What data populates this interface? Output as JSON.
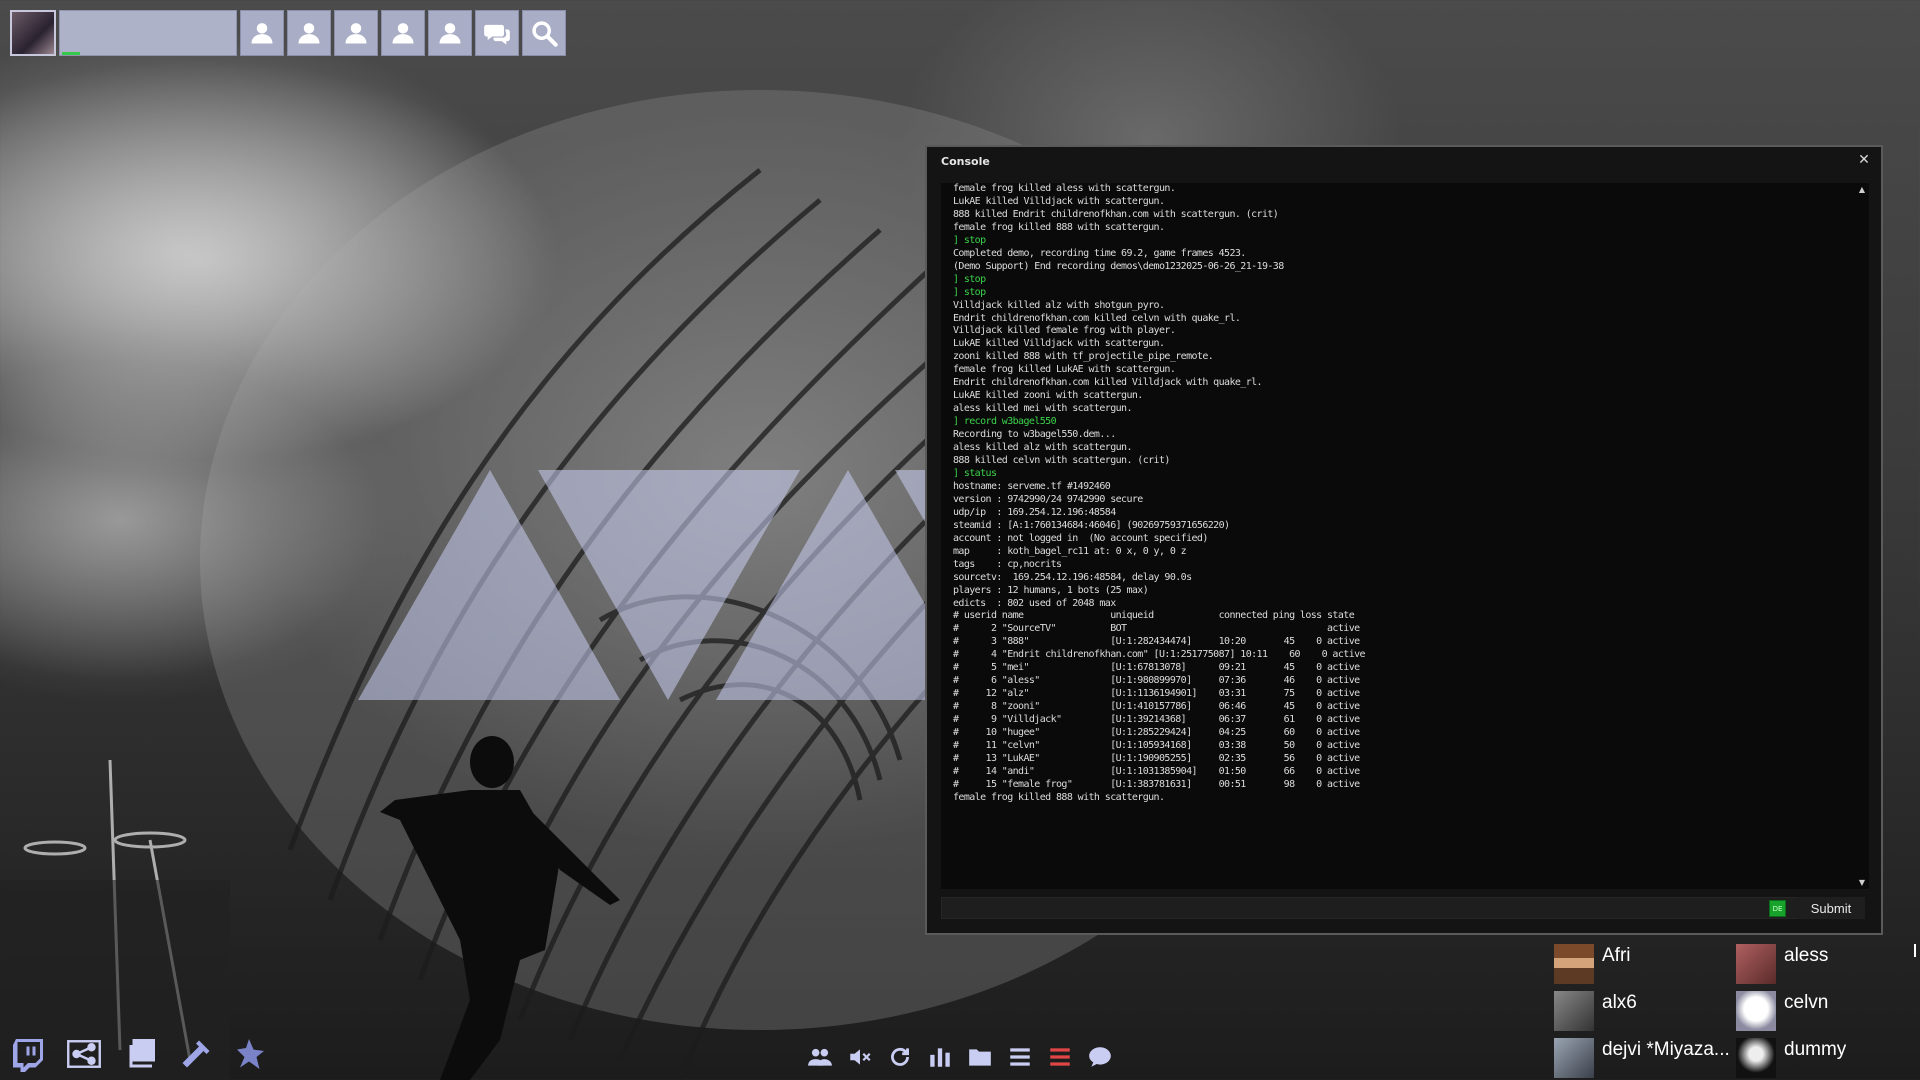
{
  "topbar": {
    "name_value": "",
    "buttons": [
      "user-icon",
      "user-icon",
      "user-icon",
      "user-icon",
      "user-icon",
      "chat-icon",
      "search-icon"
    ]
  },
  "console": {
    "title": "Console",
    "close_glyph": "✕",
    "lines": [
      {
        "text": "female frog killed aless with scattergun.",
        "cmd": false
      },
      {
        "text": "LukAE killed Villdjack with scattergun.",
        "cmd": false
      },
      {
        "text": "888 killed Endrit childrenofkhan.com with scattergun. (crit)",
        "cmd": false
      },
      {
        "text": "female frog killed 888 with scattergun.",
        "cmd": false
      },
      {
        "text": "] stop",
        "cmd": true
      },
      {
        "text": "Completed demo, recording time 69.2, game frames 4523.",
        "cmd": false
      },
      {
        "text": "(Demo Support) End recording demos\\demo1232025-06-26_21-19-38",
        "cmd": false
      },
      {
        "text": "] stop",
        "cmd": true
      },
      {
        "text": "] stop",
        "cmd": true
      },
      {
        "text": "Villdjack killed alz with shotgun_pyro.",
        "cmd": false
      },
      {
        "text": "Endrit childrenofkhan.com killed celvn with quake_rl.",
        "cmd": false
      },
      {
        "text": "Villdjack killed female frog with player.",
        "cmd": false
      },
      {
        "text": "LukAE killed Villdjack with scattergun.",
        "cmd": false
      },
      {
        "text": "zooni killed 888 with tf_projectile_pipe_remote.",
        "cmd": false
      },
      {
        "text": "female frog killed LukAE with scattergun.",
        "cmd": false
      },
      {
        "text": "Endrit childrenofkhan.com killed Villdjack with quake_rl.",
        "cmd": false
      },
      {
        "text": "LukAE killed zooni with scattergun.",
        "cmd": false
      },
      {
        "text": "aless killed mei with scattergun.",
        "cmd": false
      },
      {
        "text": "] record w3bagel550",
        "cmd": true
      },
      {
        "text": "Recording to w3bagel550.dem...",
        "cmd": false
      },
      {
        "text": "aless killed alz with scattergun.",
        "cmd": false
      },
      {
        "text": "888 killed celvn with scattergun. (crit)",
        "cmd": false
      },
      {
        "text": "] status",
        "cmd": true
      },
      {
        "text": "hostname: serveme.tf #1492460",
        "cmd": false
      },
      {
        "text": "version : 9742990/24 9742990 secure",
        "cmd": false
      },
      {
        "text": "udp/ip  : 169.254.12.196:48584",
        "cmd": false
      },
      {
        "text": "steamid : [A:1:760134684:46046] (90269759371656220)",
        "cmd": false
      },
      {
        "text": "account : not logged in  (No account specified)",
        "cmd": false
      },
      {
        "text": "map     : koth_bagel_rc11 at: 0 x, 0 y, 0 z",
        "cmd": false
      },
      {
        "text": "tags    : cp,nocrits",
        "cmd": false
      },
      {
        "text": "sourcetv:  169.254.12.196:48584, delay 90.0s",
        "cmd": false
      },
      {
        "text": "players : 12 humans, 1 bots (25 max)",
        "cmd": false
      },
      {
        "text": "edicts  : 802 used of 2048 max",
        "cmd": false
      },
      {
        "text": "# userid name                uniqueid            connected ping loss state",
        "cmd": false
      },
      {
        "text": "#      2 \"SourceTV\"          BOT                                     active",
        "cmd": false
      },
      {
        "text": "#      3 \"888\"               [U:1:282434474]     10:20       45    0 active",
        "cmd": false
      },
      {
        "text": "#      4 \"Endrit childrenofkhan.com\" [U:1:251775087] 10:11    60    0 active",
        "cmd": false
      },
      {
        "text": "#      5 \"mei\"               [U:1:67813078]      09:21       45    0 active",
        "cmd": false
      },
      {
        "text": "#      6 \"aless\"             [U:1:980899970]     07:36       46    0 active",
        "cmd": false
      },
      {
        "text": "#     12 \"alz\"               [U:1:1136194901]    03:31       75    0 active",
        "cmd": false
      },
      {
        "text": "#      8 \"zooni\"             [U:1:410157786]     06:46       45    0 active",
        "cmd": false
      },
      {
        "text": "#      9 \"Villdjack\"         [U:1:39214368]      06:37       61    0 active",
        "cmd": false
      },
      {
        "text": "#     10 \"hugee\"             [U:1:285229424]     04:25       60    0 active",
        "cmd": false
      },
      {
        "text": "#     11 \"celvn\"             [U:1:105934168]     03:38       50    0 active",
        "cmd": false
      },
      {
        "text": "#     13 \"LukAE\"             [U:1:190905255]     02:35       56    0 active",
        "cmd": false
      },
      {
        "text": "#     14 \"andi\"              [U:1:1031385904]    01:50       66    0 active",
        "cmd": false
      },
      {
        "text": "#     15 \"female frog\"       [U:1:383781631]     00:51       98    0 active",
        "cmd": false
      },
      {
        "text": "female frog killed 888 with scattergun.",
        "cmd": false
      }
    ],
    "input_value": "",
    "de_label": "DE",
    "submit_label": "Submit"
  },
  "players": [
    {
      "name": "Afri",
      "avatar_color": "#8a5a3a"
    },
    {
      "name": "aless",
      "avatar_color": "#9a4c4c"
    },
    {
      "name": "alx6",
      "avatar_color": "#5a5a5a"
    },
    {
      "name": "celvn",
      "avatar_color": "#c8c8d8"
    },
    {
      "name": "dejvi *Miyaza...",
      "avatar_color": "#6a7482"
    },
    {
      "name": "dummy",
      "avatar_color": "#202020"
    }
  ],
  "bottom_left_icons": [
    "twitch-icon",
    "share-icon",
    "windows-icon",
    "hammer-icon",
    "spark-icon"
  ],
  "bottom_center_icons": [
    "friends-icon",
    "mute-icon",
    "refresh-icon",
    "stats-icon",
    "folder-icon",
    "menu-icon",
    "list-red-icon",
    "chat-bubble-icon"
  ],
  "colors": {
    "accent_green": "#3bd24a",
    "toolbar_bg": "#a9adc6",
    "red_icon": "#e24545"
  }
}
